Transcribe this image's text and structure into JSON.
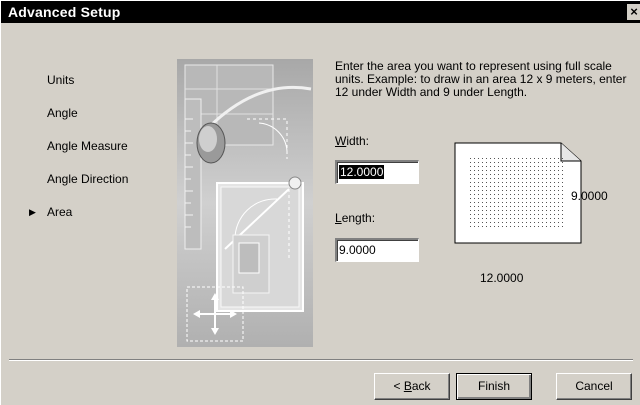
{
  "window": {
    "title": "Advanced Setup"
  },
  "steps": [
    {
      "label": "Units"
    },
    {
      "label": "Angle"
    },
    {
      "label": "Angle Measure"
    },
    {
      "label": "Angle Direction"
    },
    {
      "label": "Area",
      "current": true
    }
  ],
  "instruction": "Enter the area you want to represent using full scale units.  Example: to draw in an area 12 x 9 meters, enter 12 under Width and 9 under Length.",
  "width": {
    "label_hotkey": "W",
    "label_rest": "idth:",
    "value": "12.0000"
  },
  "length": {
    "label_hotkey": "L",
    "label_rest": "ength:",
    "value": "9.0000"
  },
  "preview": {
    "width_value": "12.0000",
    "length_value": "9.0000"
  },
  "buttons": {
    "back_prefix": "< ",
    "back_hotkey": "B",
    "back_rest": "ack",
    "finish": "Finish",
    "cancel": "Cancel"
  }
}
